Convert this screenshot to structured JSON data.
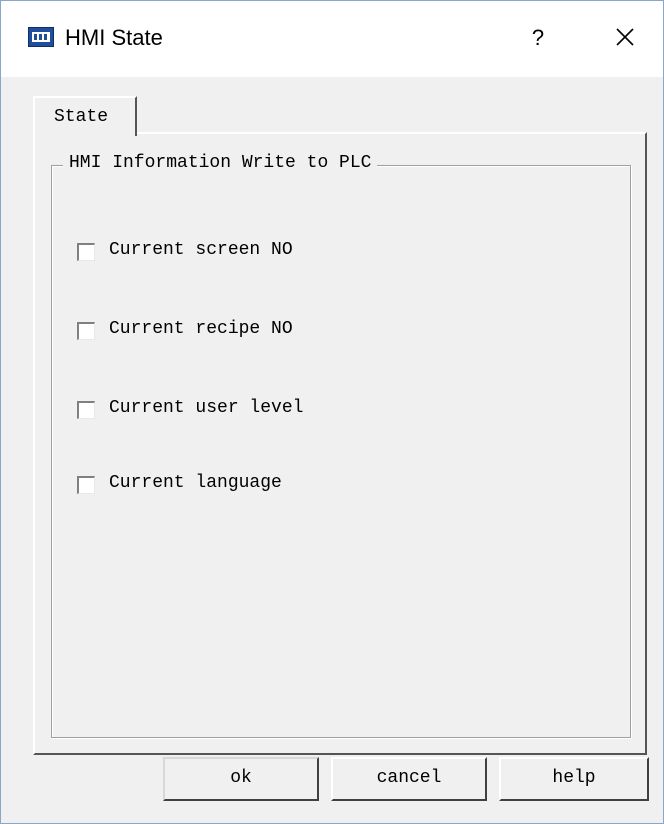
{
  "window": {
    "title": "HMI State",
    "help_glyph": "?",
    "close_icon": "close-icon",
    "app_icon": "hmi-app-icon",
    "border_color": "#8aa6c8"
  },
  "tabs": [
    {
      "label": "State",
      "selected": true
    }
  ],
  "group": {
    "legend": "HMI Information Write to PLC"
  },
  "checkboxes": [
    {
      "label": "Current screen NO",
      "checked": false
    },
    {
      "label": "Current recipe NO",
      "checked": false
    },
    {
      "label": "Current user level",
      "checked": false
    },
    {
      "label": "Current language",
      "checked": false
    }
  ],
  "buttons": {
    "ok": "ok",
    "cancel": "cancel",
    "help": "help"
  }
}
